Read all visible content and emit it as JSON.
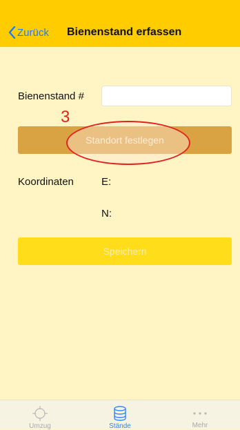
{
  "navbar": {
    "back_label": "Zurück",
    "title": "Bienenstand erfassen",
    "background": "#FFCC00",
    "accent": "#1E7BFF"
  },
  "form": {
    "hive_label": "Bienenstand #",
    "hive_value": "",
    "hive_placeholder": "",
    "set_location_label": "Standort festlegen",
    "coordinates_label": "Koordinaten",
    "east_label": "E:",
    "east_value": "",
    "north_label": "N:",
    "north_value": "",
    "save_label": "Speichern"
  },
  "annotation": {
    "number": "3",
    "color": "#E0241D"
  },
  "tabbar": {
    "items": [
      {
        "label": "Umzug",
        "icon": "crosshair-icon",
        "active": false
      },
      {
        "label": "Stände",
        "icon": "database-icon",
        "active": true
      },
      {
        "label": "Mehr",
        "icon": "more-dots-icon",
        "active": false
      }
    ]
  }
}
